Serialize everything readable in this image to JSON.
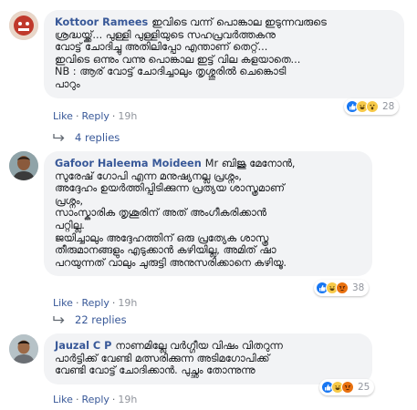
{
  "comments": [
    {
      "author": "Kottoor Ramees",
      "lines": [
        "ഇവിടെ വന്ന് പൊങ്കാല ഇടുന്നവരുടെ",
        "ശ്രദ്ധയ്ക്ക്... പുള്ളി പുള്ളിയുടെ സഹപ്രവർത്തകനു",
        "വോട്ട് ചോദിച്ചു അതിലിപ്പോ എന്താണ് തെറ്റ്...",
        "ഇവിടെ ഒന്നും വന്നു പൊങ്കാല ഇട്ട് വില കളയാതെ...",
        "NB : ആര് വോട്ട് ചോദിച്ചാലും തൃശ്ശൂരിൽ ചെങ്കൊടി",
        "പാറും"
      ],
      "like_label": "Like",
      "reply_label": "Reply",
      "time": "19h",
      "reaction_count": "28",
      "reactions": [
        "like-icon",
        "haha-icon",
        "wow-icon"
      ],
      "replies_label": "4 replies"
    },
    {
      "author": "Gafoor Haleema Moideen",
      "lines": [
        "Mr ബിജു മേനോൻ,",
        "സുരേഷ് ഗോപി എന്ന മനുഷ്യനല്ല പ്രശ്നം,",
        "അദ്ദേഹം ഉയർത്തിപ്പിടിക്കുന്ന പ്രത്യയ ശാസ്ത്രമാണ്",
        "പ്രശ്നം,",
        "സാംസ്കാരിക തൃശൂരിന് അത് അംഗീകരിക്കാൻ",
        "പറ്റില്ല.",
        "ജയിച്ചാലും അദ്ദേഹത്തിന് ഒരു പ്രത്യേക ശാസ്ത്ര",
        "തീരുമാനങ്ങളും എടുക്കാൻ കഴിയില്ല, അമിത് ഷാ",
        "പറയുന്നത് വാലും ചുരുട്ടി അനുസരിക്കാനെ കഴിയൂ."
      ],
      "like_label": "Like",
      "reply_label": "Reply",
      "time": "19h",
      "reaction_count": "38",
      "reactions": [
        "like-icon",
        "haha-icon",
        "angry-icon"
      ],
      "replies_label": "22 replies"
    },
    {
      "author": "Jauzal C P",
      "lines": [
        "നാണമില്ലേ വർഗ്ഗീയ വിഷം വിതറുന്ന",
        "പാർട്ടിക്ക് വേണ്ടി മത്സരിക്കുന്ന അടിമഗോപിക്ക്",
        "വേണ്ടി വോട്ട് ചോദിക്കാൻ. പുച്ഛം തോന്നുന്നു"
      ],
      "like_label": "Like",
      "reply_label": "Reply",
      "time": "19h",
      "reaction_count": "25",
      "reactions": [
        "like-icon",
        "haha-icon",
        "angry-icon"
      ]
    }
  ],
  "colors": {
    "link": "#385898",
    "bubble": "#f2f3f5",
    "meta": "#606770",
    "like": "#1877f2"
  }
}
